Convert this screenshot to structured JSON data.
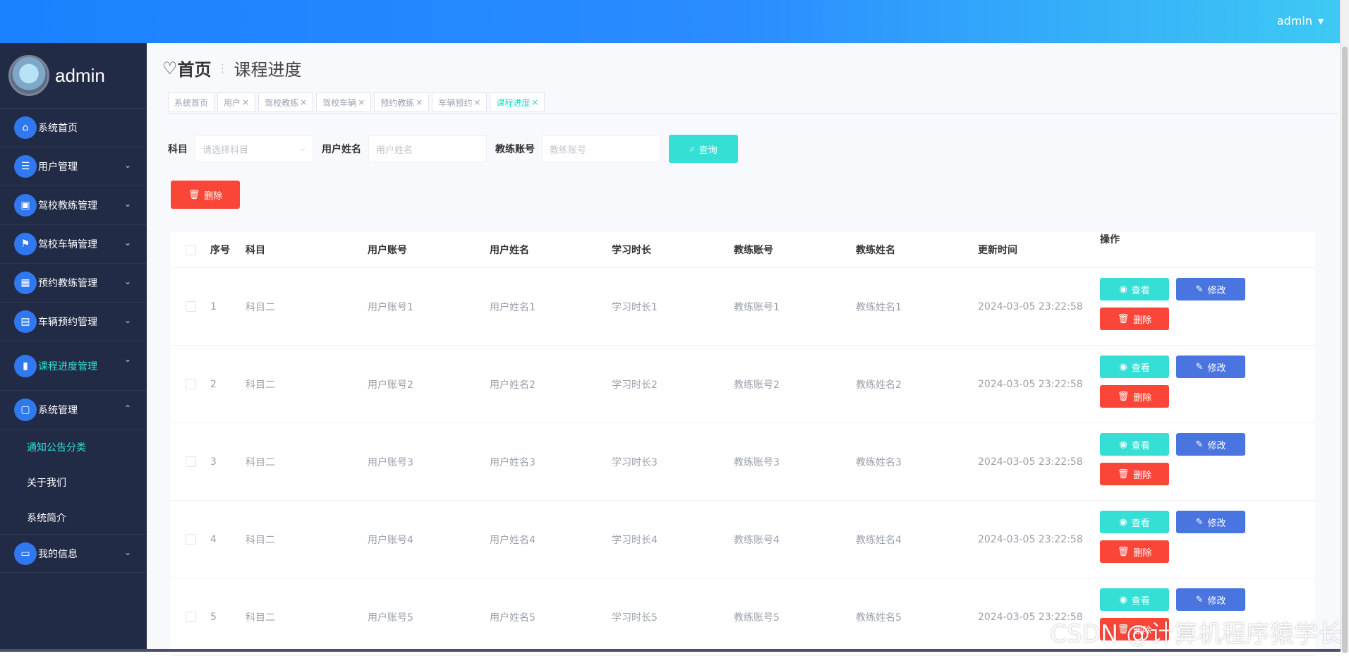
{
  "topbar": {
    "user": "admin"
  },
  "sidebar": {
    "brand_name": "admin",
    "items": [
      {
        "label": "系统首页",
        "icon": "home-icon",
        "glyph": "⌂",
        "has_chevron": false
      },
      {
        "label": "用户管理",
        "icon": "list-icon",
        "glyph": "☰",
        "has_chevron": true
      },
      {
        "label": "驾校教练管理",
        "icon": "briefcase-icon",
        "glyph": "▣",
        "has_chevron": true
      },
      {
        "label": "驾校车辆管理",
        "icon": "flag-icon",
        "glyph": "⚑",
        "has_chevron": true
      },
      {
        "label": "预约教练管理",
        "icon": "grid-icon",
        "glyph": "▦",
        "has_chevron": true
      },
      {
        "label": "车辆预约管理",
        "icon": "clipboard-icon",
        "glyph": "▤",
        "has_chevron": true
      },
      {
        "label": "课程进度管理",
        "icon": "bar-chart-icon",
        "glyph": "▮",
        "has_chevron": true
      },
      {
        "label": "系统管理",
        "icon": "message-icon",
        "glyph": "▢",
        "has_chevron": true
      }
    ],
    "sub_items": [
      "通知公告分类",
      "关于我们",
      "系统简介"
    ],
    "last_item": {
      "label": "我的信息",
      "icon": "card-icon",
      "glyph": "▭"
    }
  },
  "breadcrumb": {
    "home": "首页",
    "current": "课程进度"
  },
  "tabs": [
    {
      "label": "系统首页",
      "closable": false
    },
    {
      "label": "用户",
      "closable": true
    },
    {
      "label": "驾校教练",
      "closable": true
    },
    {
      "label": "驾校车辆",
      "closable": true
    },
    {
      "label": "预约教练",
      "closable": true
    },
    {
      "label": "车辆预约",
      "closable": true
    },
    {
      "label": "课程进度",
      "closable": true,
      "active": true
    }
  ],
  "search": {
    "subject_label": "科目",
    "subject_placeholder": "请选择科目",
    "username_label": "用户姓名",
    "username_placeholder": "用户姓名",
    "coach_label": "教练账号",
    "coach_placeholder": "教练账号",
    "query_button": "查询"
  },
  "actions": {
    "delete_button": "删除"
  },
  "table": {
    "headers": [
      "序号",
      "科目",
      "用户账号",
      "用户姓名",
      "学习时长",
      "教练账号",
      "教练姓名",
      "更新时间",
      "操作"
    ],
    "view_label": "查看",
    "edit_label": "修改",
    "delete_label": "删除",
    "rows": [
      [
        "1",
        "科目二",
        "用户账号1",
        "用户姓名1",
        "学习时长1",
        "教练账号1",
        "教练姓名1",
        "2024-03-05 23:22:58"
      ],
      [
        "2",
        "科目二",
        "用户账号2",
        "用户姓名2",
        "学习时长2",
        "教练账号2",
        "教练姓名2",
        "2024-03-05 23:22:58"
      ],
      [
        "3",
        "科目二",
        "用户账号3",
        "用户姓名3",
        "学习时长3",
        "教练账号3",
        "教练姓名3",
        "2024-03-05 23:22:58"
      ],
      [
        "4",
        "科目二",
        "用户账号4",
        "用户姓名4",
        "学习时长4",
        "教练账号4",
        "教练姓名4",
        "2024-03-05 23:22:58"
      ],
      [
        "5",
        "科目二",
        "用户账号5",
        "用户姓名5",
        "学习时长5",
        "教练账号5",
        "教练姓名5",
        "2024-03-05 23:22:58"
      ]
    ]
  },
  "watermark": "CSDN @计算机程序猿学长",
  "colors": {
    "primary": "#2f78f0",
    "accent": "#35dfd6",
    "danger": "#f94638",
    "edit": "#4a74e0",
    "sidebar_bg": "#222b45"
  }
}
